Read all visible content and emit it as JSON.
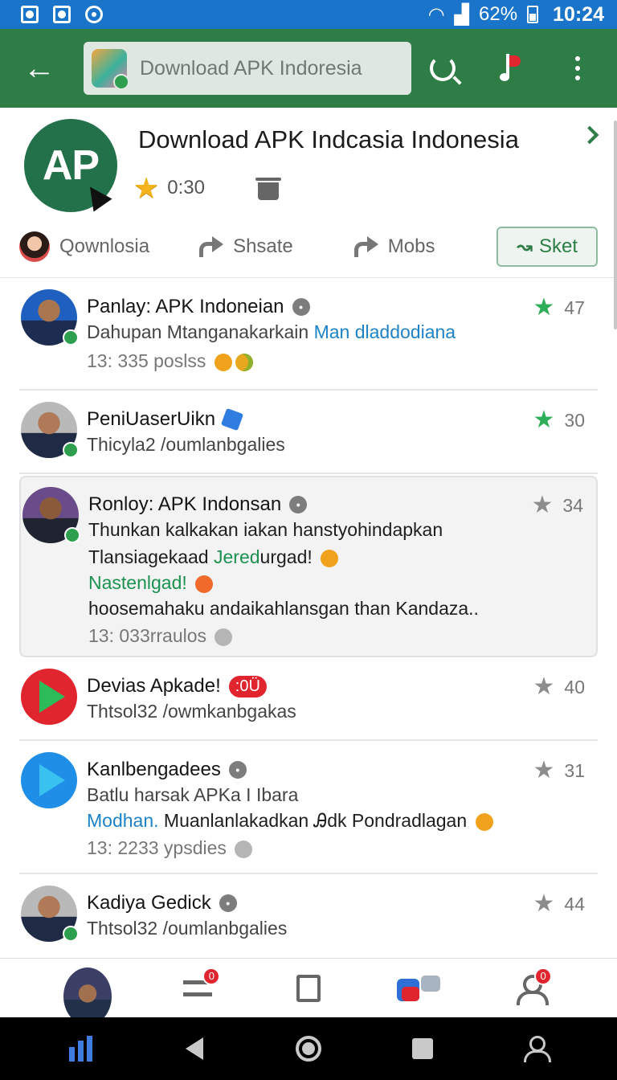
{
  "status_bar": {
    "battery": "62%",
    "time": "10:24"
  },
  "toolbar": {
    "search_text": "Download APK Indoresia"
  },
  "header": {
    "logo_text": "AP",
    "title": "Download APK Indcasia Indonesia",
    "rating": "0:30",
    "actions": [
      {
        "label": "Qownlosia"
      },
      {
        "label": "Shsate"
      },
      {
        "label": "Mobs"
      }
    ],
    "primary_action": "Sket"
  },
  "feed": [
    {
      "name": "Panlay: APK Indoneian",
      "score": "47",
      "line1": "Dahupan Mtanganakarkain ",
      "line1_link": "Man dladdodiana",
      "meta": "13: 335 poslss"
    },
    {
      "name": "PeniUaserUikn",
      "score": "30",
      "line1": "Thicyla2 /oumlanbgalies"
    },
    {
      "name": "Ronloy: APK Indonsan",
      "score": "34",
      "line1": "Thunkan kalkakan iakan hanstyohindapkan",
      "line2_a": "Tlansiagekaad ",
      "line2_b": "Jered",
      "line2_c": "urgad!",
      "line3": "Nastenlgad!",
      "line4": "hoosemahaku andaikahlansgan than Kandaza..",
      "meta": "13: 033rraulos"
    },
    {
      "name": "Devias Apkade!",
      "badge": ":0Ü",
      "score": "40",
      "line1": "Thtsol32 /owmkanbgakas"
    },
    {
      "name": "Kanlbengadees",
      "score": "31",
      "line1": "Batlu harsak APKa I Ibara",
      "line2_link": "Modhan.",
      "line2_rest": " Muanlanlakadkan Ꭿdk Pondradlagan",
      "meta": "13: 2233 ypsdies"
    },
    {
      "name": "Kadiya Gedick",
      "score": "44",
      "line1": "Thtsol32 /oumlanbgalies"
    }
  ],
  "bottom_tabs": {
    "badge1": "0",
    "badge2": "0"
  },
  "colors": {
    "toolbar": "#2e7d46",
    "status_bar": "#1a74c9",
    "accent_green": "#2fae59"
  }
}
